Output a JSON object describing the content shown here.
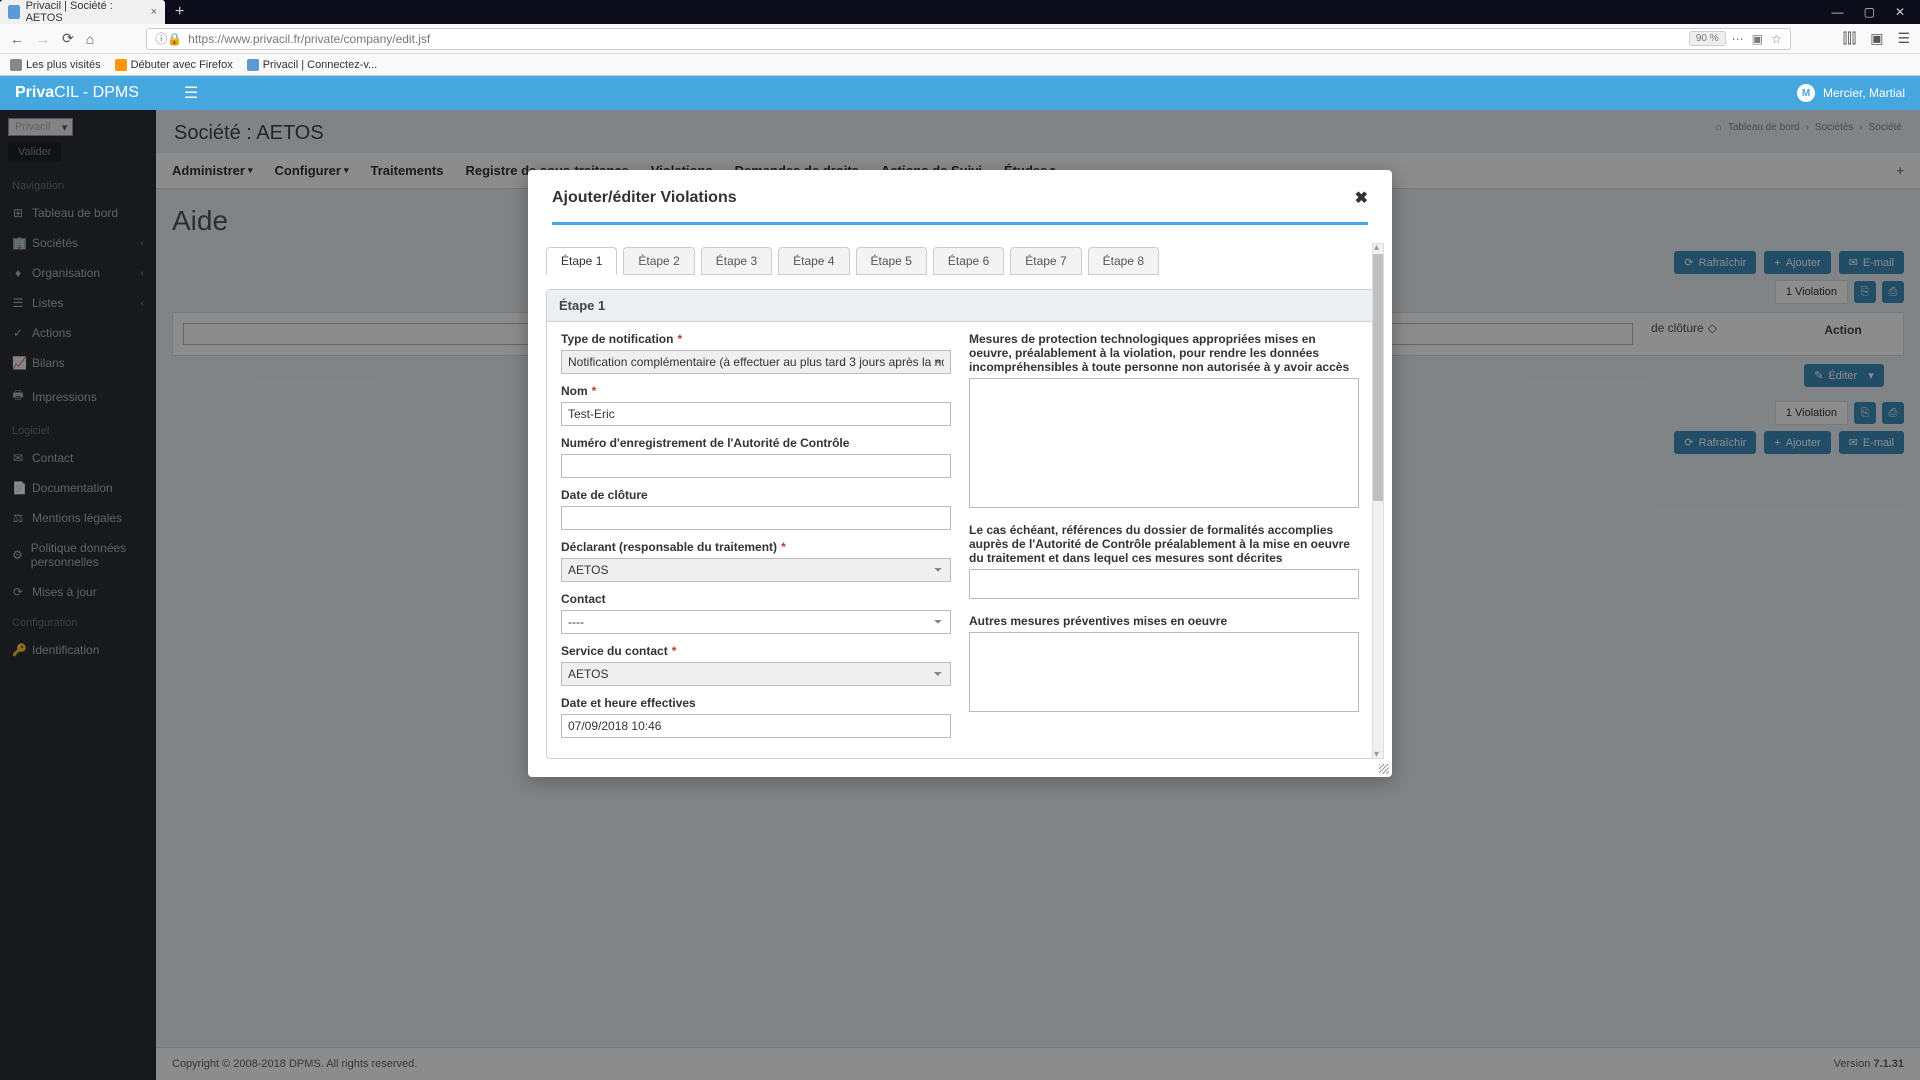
{
  "browser": {
    "tab_title": "Privacil | Société : AETOS",
    "url": "https://www.privacil.fr/private/company/edit.jsf",
    "zoom": "90 %",
    "bookmarks": [
      "Les plus visités",
      "Débuter avec Firefox",
      "Privacil | Connectez-v..."
    ]
  },
  "app": {
    "brand_a": "Priva",
    "brand_b": "CIL",
    "brand_c": " - DPMS",
    "user": "Mercier, Martial"
  },
  "sidebar": {
    "tenant": "Privacil",
    "validate": "Valider",
    "section_nav": "Navigation",
    "items_nav": [
      "Tableau de bord",
      "Sociétés",
      "Organisation",
      "Listes",
      "Actions",
      "Bilans",
      "Impressions"
    ],
    "section_log": "Logiciel",
    "items_log": [
      "Contact",
      "Documentation",
      "Mentions légales",
      "Politique données personnelles",
      "Mises à jour"
    ],
    "section_cfg": "Configuration",
    "items_cfg": [
      "Identification"
    ]
  },
  "page": {
    "title": "Société : AETOS",
    "breadcrumb": [
      "Tableau de bord",
      "Sociétés",
      "Société"
    ],
    "tabs": [
      "Administrer",
      "Configurer",
      "Traitements",
      "Registre de sous-traitance",
      "Violations",
      "Demandes de droits",
      "Actions de Suivi",
      "Études"
    ],
    "aide": "Aide",
    "refresh": "Rafraîchir",
    "add": "Ajouter",
    "email": "E-mail",
    "count": "1 Violation",
    "closure_hdr": "de clôture",
    "action_hdr": "Action",
    "edit_btn": "Éditer"
  },
  "modal": {
    "title": "Ajouter/éditer Violations",
    "steps": [
      "Étape 1",
      "Étape 2",
      "Étape 3",
      "Étape 4",
      "Étape 5",
      "Étape 6",
      "Étape 7",
      "Étape 8"
    ],
    "panel_title": "Étape 1",
    "left": {
      "type_label": "Type de notification",
      "type_value": "Notification complémentaire (à effectuer au plus tard 3 jours après la nc",
      "nom_label": "Nom",
      "nom_value": "Test-Eric",
      "numero_label": "Numéro d'enregistrement de l'Autorité de Contrôle",
      "date_cloture_label": "Date de clôture",
      "declarant_label": "Déclarant (responsable du traitement)",
      "declarant_value": "AETOS",
      "contact_label": "Contact",
      "contact_value": "----",
      "service_label": "Service du contact",
      "service_value": "AETOS",
      "datetime_label": "Date et heure effectives",
      "datetime_value": "07/09/2018 10:46"
    },
    "right": {
      "mesures_label": "Mesures de protection technologiques appropriées mises en oeuvre, préalablement à la violation, pour rendre les données incompréhensibles à toute personne non autorisée à y avoir accès",
      "references_label": "Le cas échéant, références du dossier de formalités accomplies auprès de l'Autorité de Contrôle préalablement à la mise en oeuvre du traitement et dans lequel ces mesures sont décrites",
      "autres_label": "Autres mesures préventives mises en oeuvre"
    }
  },
  "footer": {
    "copyright": "Copyright © 2008-2018 DPMS. All rights reserved.",
    "version_label": "Version ",
    "version": "7.1.31"
  }
}
